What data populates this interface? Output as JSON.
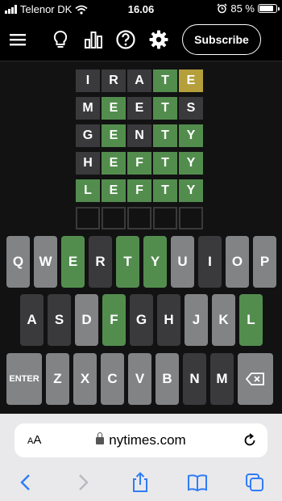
{
  "status_bar": {
    "carrier": "Telenor DK",
    "time": "16.06",
    "battery": "85 %",
    "battery_level": 0.85
  },
  "header": {
    "subscribe_label": "Subscribe",
    "icons": [
      "menu-icon",
      "lightbulb-icon",
      "stats-icon",
      "help-icon",
      "settings-icon"
    ]
  },
  "board": {
    "rows": [
      [
        {
          "letter": "I",
          "state": "absent"
        },
        {
          "letter": "R",
          "state": "absent"
        },
        {
          "letter": "A",
          "state": "absent"
        },
        {
          "letter": "T",
          "state": "correct"
        },
        {
          "letter": "E",
          "state": "present"
        }
      ],
      [
        {
          "letter": "M",
          "state": "absent"
        },
        {
          "letter": "E",
          "state": "correct"
        },
        {
          "letter": "E",
          "state": "absent"
        },
        {
          "letter": "T",
          "state": "correct"
        },
        {
          "letter": "S",
          "state": "absent"
        }
      ],
      [
        {
          "letter": "G",
          "state": "absent"
        },
        {
          "letter": "E",
          "state": "correct"
        },
        {
          "letter": "N",
          "state": "absent"
        },
        {
          "letter": "T",
          "state": "correct"
        },
        {
          "letter": "Y",
          "state": "correct"
        }
      ],
      [
        {
          "letter": "H",
          "state": "absent"
        },
        {
          "letter": "E",
          "state": "correct"
        },
        {
          "letter": "F",
          "state": "correct"
        },
        {
          "letter": "T",
          "state": "correct"
        },
        {
          "letter": "Y",
          "state": "correct"
        }
      ],
      [
        {
          "letter": "L",
          "state": "correct"
        },
        {
          "letter": "E",
          "state": "correct"
        },
        {
          "letter": "F",
          "state": "correct"
        },
        {
          "letter": "T",
          "state": "correct"
        },
        {
          "letter": "Y",
          "state": "correct"
        }
      ],
      [
        {
          "letter": "",
          "state": "empty"
        },
        {
          "letter": "",
          "state": "empty"
        },
        {
          "letter": "",
          "state": "empty"
        },
        {
          "letter": "",
          "state": "empty"
        },
        {
          "letter": "",
          "state": "empty"
        }
      ]
    ]
  },
  "keyboard": {
    "rows": [
      [
        {
          "label": "Q",
          "state": "unused"
        },
        {
          "label": "W",
          "state": "unused"
        },
        {
          "label": "E",
          "state": "correct"
        },
        {
          "label": "R",
          "state": "absent"
        },
        {
          "label": "T",
          "state": "correct"
        },
        {
          "label": "Y",
          "state": "correct"
        },
        {
          "label": "U",
          "state": "unused"
        },
        {
          "label": "I",
          "state": "absent"
        },
        {
          "label": "O",
          "state": "unused"
        },
        {
          "label": "P",
          "state": "unused"
        }
      ],
      [
        {
          "label": "A",
          "state": "absent"
        },
        {
          "label": "S",
          "state": "absent"
        },
        {
          "label": "D",
          "state": "unused"
        },
        {
          "label": "F",
          "state": "correct"
        },
        {
          "label": "G",
          "state": "absent"
        },
        {
          "label": "H",
          "state": "absent"
        },
        {
          "label": "J",
          "state": "unused"
        },
        {
          "label": "K",
          "state": "unused"
        },
        {
          "label": "L",
          "state": "correct"
        }
      ],
      [
        {
          "label": "ENTER",
          "state": "unused",
          "wide": true
        },
        {
          "label": "Z",
          "state": "unused"
        },
        {
          "label": "X",
          "state": "unused"
        },
        {
          "label": "C",
          "state": "unused"
        },
        {
          "label": "V",
          "state": "unused"
        },
        {
          "label": "B",
          "state": "unused"
        },
        {
          "label": "N",
          "state": "absent"
        },
        {
          "label": "M",
          "state": "absent"
        },
        {
          "label": "",
          "state": "unused",
          "wide": true,
          "icon": "backspace-icon"
        }
      ]
    ]
  },
  "safari": {
    "text_size_label_small": "A",
    "text_size_label_large": "A",
    "url": "nytimes.com"
  },
  "colors": {
    "correct": "#538d4e",
    "present": "#b59f3b",
    "absent": "#3a3a3c",
    "unused": "#818384",
    "background": "#121213"
  }
}
